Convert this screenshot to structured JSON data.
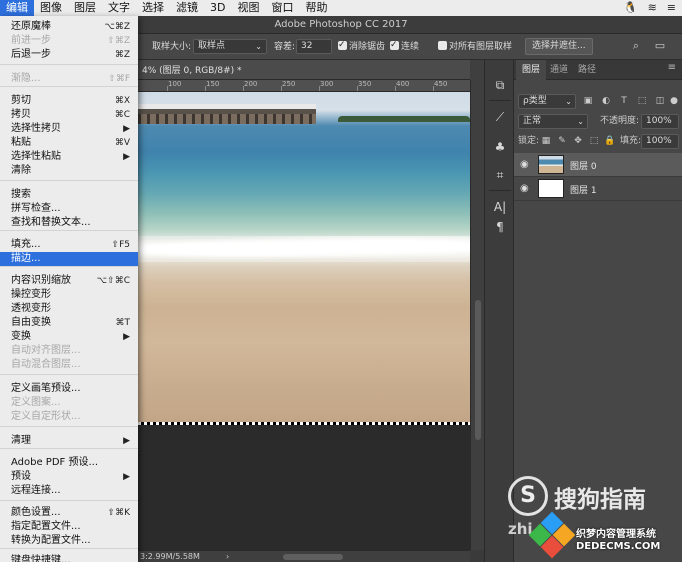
{
  "menubar": {
    "items": [
      "编辑",
      "图像",
      "图层",
      "文字",
      "选择",
      "滤镜",
      "3D",
      "视图",
      "窗口",
      "帮助"
    ],
    "active_index": 0
  },
  "window": {
    "title": "Adobe Photoshop CC 2017"
  },
  "options_bar": {
    "sample_size_label": "取样大小:",
    "sample_size_value": "取样点",
    "tolerance_label": "容差:",
    "tolerance_value": "32",
    "anti_alias_label": "消除锯齿",
    "anti_alias_checked": true,
    "contiguous_label": "连续",
    "contiguous_checked": true,
    "sample_all_layers_label": "对所有图层取样",
    "sample_all_layers_checked": false,
    "select_mask_button": "选择并遮住..."
  },
  "document": {
    "tab_label": "4% (图层 0, RGB/8#) *",
    "ruler_ticks": [
      "100",
      "150",
      "200",
      "250",
      "300",
      "350",
      "400",
      "450"
    ],
    "status": "3:2.99M/5.58M",
    "status_arrow": "›"
  },
  "edit_menu": {
    "items": [
      {
        "label": "还原魔棒",
        "shortcut": "⌥⌘Z",
        "disabled": false
      },
      {
        "label": "前进一步",
        "shortcut": "⇧⌘Z",
        "disabled": true
      },
      {
        "label": "后退一步",
        "shortcut": "⌘Z",
        "disabled": false
      },
      {
        "label": "渐隐...",
        "shortcut": "⇧⌘F",
        "disabled": true
      },
      {
        "label": "剪切",
        "shortcut": "⌘X",
        "disabled": false
      },
      {
        "label": "拷贝",
        "shortcut": "⌘C",
        "disabled": false
      },
      {
        "label": "选择性拷贝",
        "shortcut": "▶",
        "disabled": false
      },
      {
        "label": "粘贴",
        "shortcut": "⌘V",
        "disabled": false
      },
      {
        "label": "选择性粘贴",
        "shortcut": "▶",
        "disabled": false
      },
      {
        "label": "清除",
        "shortcut": "",
        "disabled": false
      },
      {
        "label": "搜索",
        "shortcut": "",
        "disabled": false
      },
      {
        "label": "拼写检查...",
        "shortcut": "",
        "disabled": false
      },
      {
        "label": "查找和替换文本...",
        "shortcut": "",
        "disabled": false
      },
      {
        "label": "填充...",
        "shortcut": "⇧F5",
        "disabled": false
      },
      {
        "label": "描边...",
        "shortcut": "",
        "disabled": false
      },
      {
        "label": "内容识别缩放",
        "shortcut": "⌥⇧⌘C",
        "disabled": false
      },
      {
        "label": "操控变形",
        "shortcut": "",
        "disabled": false
      },
      {
        "label": "透视变形",
        "shortcut": "",
        "disabled": false
      },
      {
        "label": "自由变换",
        "shortcut": "⌘T",
        "disabled": false
      },
      {
        "label": "变换",
        "shortcut": "▶",
        "disabled": false
      },
      {
        "label": "自动对齐图层...",
        "shortcut": "",
        "disabled": true
      },
      {
        "label": "自动混合图层...",
        "shortcut": "",
        "disabled": true
      },
      {
        "label": "定义画笔预设...",
        "shortcut": "",
        "disabled": false
      },
      {
        "label": "定义图案...",
        "shortcut": "",
        "disabled": true
      },
      {
        "label": "定义自定形状...",
        "shortcut": "",
        "disabled": true
      },
      {
        "label": "清理",
        "shortcut": "▶",
        "disabled": false
      },
      {
        "label": "Adobe PDF 预设...",
        "shortcut": "",
        "disabled": false
      },
      {
        "label": "预设",
        "shortcut": "▶",
        "disabled": false
      },
      {
        "label": "远程连接...",
        "shortcut": "",
        "disabled": false
      },
      {
        "label": "颜色设置...",
        "shortcut": "⇧⌘K",
        "disabled": false
      },
      {
        "label": "指定配置文件...",
        "shortcut": "",
        "disabled": false
      },
      {
        "label": "转换为配置文件...",
        "shortcut": "",
        "disabled": false
      },
      {
        "label": "键盘快捷键...",
        "shortcut": "",
        "disabled": false
      }
    ],
    "highlighted_index": 14
  },
  "layers_panel": {
    "tabs": [
      "图层",
      "通道",
      "路径"
    ],
    "active_tab": 0,
    "filter_kind": "ρ类型",
    "blend_mode": "正常",
    "opacity_label": "不透明度:",
    "opacity_value": "100%",
    "lock_label": "锁定:",
    "fill_label": "填充:",
    "fill_value": "100%",
    "layers": [
      {
        "name": "图层 0",
        "selected": true
      },
      {
        "name": "图层 1",
        "selected": false
      }
    ]
  },
  "watermark": {
    "sogou_text": "搜狗指南",
    "sogou_sub": "zhi",
    "brand_cn": "织梦内容管理系统",
    "brand_domain": "DEDECMS.COM"
  },
  "menubar_right": {
    "wechat_icon": "🐧",
    "wifi_icon": "wifi",
    "extra_icon": "≡"
  }
}
